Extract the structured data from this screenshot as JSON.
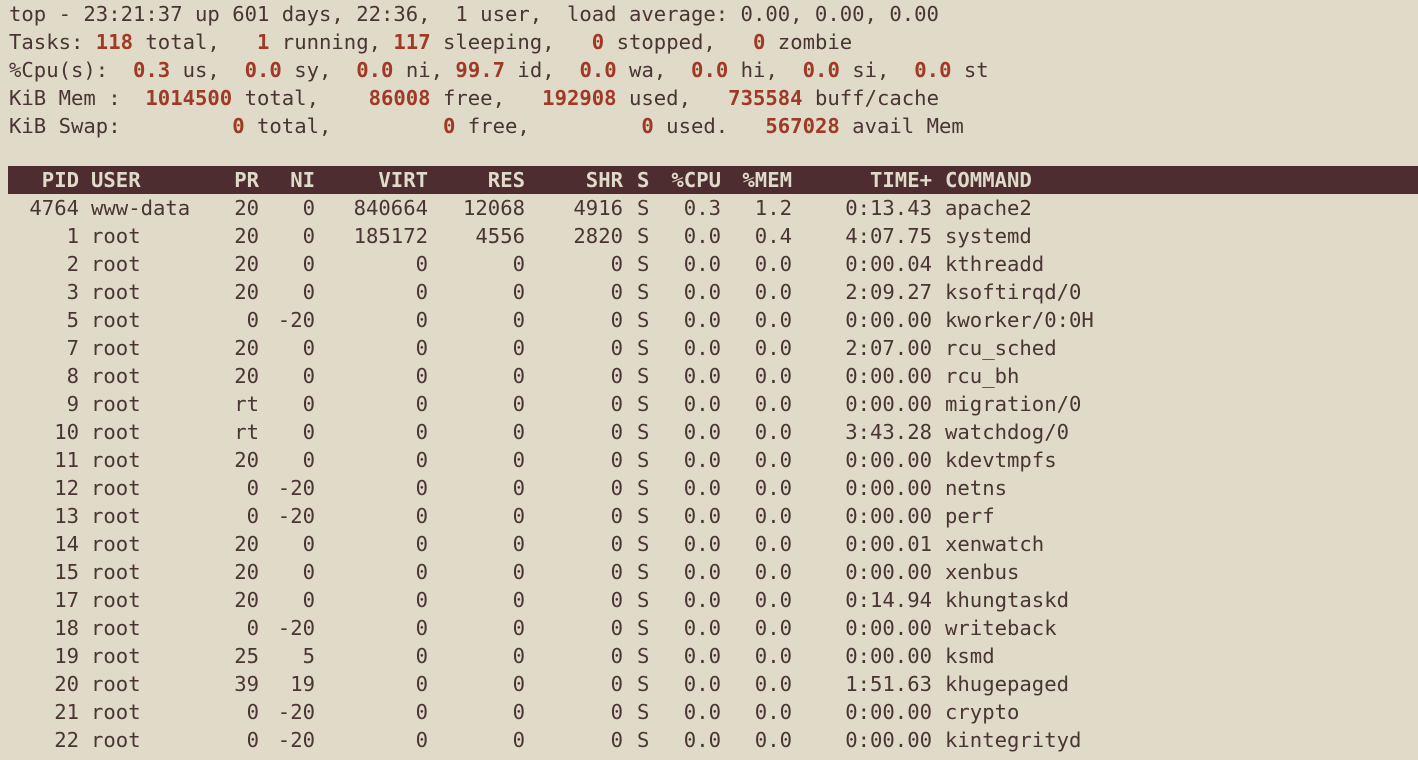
{
  "summary": {
    "line1": {
      "prefix": "top - ",
      "time": "23:21:37",
      "uptime": " up 601 days, 22:36,  1 user,  load average: 0.00, 0.00, 0.00"
    },
    "tasks": {
      "label": "Tasks: ",
      "total": "118",
      "total_label": " total,   ",
      "running": "1",
      "running_label": " running, ",
      "sleeping": "117",
      "sleeping_label": " sleeping,   ",
      "stopped": "0",
      "stopped_label": " stopped,   ",
      "zombie": "0",
      "zombie_label": " zombie"
    },
    "cpu": {
      "label": "%Cpu(s):  ",
      "us": "0.3",
      "us_label": " us,  ",
      "sy": "0.0",
      "sy_label": " sy,  ",
      "ni": "0.0",
      "ni_label": " ni, ",
      "id": "99.7",
      "id_label": " id,  ",
      "wa": "0.0",
      "wa_label": " wa,  ",
      "hi": "0.0",
      "hi_label": " hi,  ",
      "si": "0.0",
      "si_label": " si,  ",
      "st": "0.0",
      "st_label": " st"
    },
    "mem": {
      "label": "KiB Mem :  ",
      "total": "1014500",
      "total_label": " total,    ",
      "free": "86008",
      "free_label": " free,   ",
      "used": "192908",
      "used_label": " used,   ",
      "buff": "735584",
      "buff_label": " buff/cache"
    },
    "swap": {
      "label": "KiB Swap:         ",
      "total": "0",
      "total_label": " total,         ",
      "free": "0",
      "free_label": " free,         ",
      "used": "0",
      "used_label": " used.   ",
      "avail": "567028",
      "avail_label": " avail Mem"
    }
  },
  "columns": [
    "PID",
    "USER",
    "PR",
    "NI",
    "VIRT",
    "RES",
    "SHR",
    "S",
    "%CPU",
    "%MEM",
    "TIME+",
    "COMMAND"
  ],
  "processes": [
    [
      "4764",
      "www-data",
      "20",
      "0",
      "840664",
      "12068",
      "4916",
      "S",
      "0.3",
      "1.2",
      "0:13.43",
      "apache2"
    ],
    [
      "1",
      "root",
      "20",
      "0",
      "185172",
      "4556",
      "2820",
      "S",
      "0.0",
      "0.4",
      "4:07.75",
      "systemd"
    ],
    [
      "2",
      "root",
      "20",
      "0",
      "0",
      "0",
      "0",
      "S",
      "0.0",
      "0.0",
      "0:00.04",
      "kthreadd"
    ],
    [
      "3",
      "root",
      "20",
      "0",
      "0",
      "0",
      "0",
      "S",
      "0.0",
      "0.0",
      "2:09.27",
      "ksoftirqd/0"
    ],
    [
      "5",
      "root",
      "0",
      "-20",
      "0",
      "0",
      "0",
      "S",
      "0.0",
      "0.0",
      "0:00.00",
      "kworker/0:0H"
    ],
    [
      "7",
      "root",
      "20",
      "0",
      "0",
      "0",
      "0",
      "S",
      "0.0",
      "0.0",
      "2:07.00",
      "rcu_sched"
    ],
    [
      "8",
      "root",
      "20",
      "0",
      "0",
      "0",
      "0",
      "S",
      "0.0",
      "0.0",
      "0:00.00",
      "rcu_bh"
    ],
    [
      "9",
      "root",
      "rt",
      "0",
      "0",
      "0",
      "0",
      "S",
      "0.0",
      "0.0",
      "0:00.00",
      "migration/0"
    ],
    [
      "10",
      "root",
      "rt",
      "0",
      "0",
      "0",
      "0",
      "S",
      "0.0",
      "0.0",
      "3:43.28",
      "watchdog/0"
    ],
    [
      "11",
      "root",
      "20",
      "0",
      "0",
      "0",
      "0",
      "S",
      "0.0",
      "0.0",
      "0:00.00",
      "kdevtmpfs"
    ],
    [
      "12",
      "root",
      "0",
      "-20",
      "0",
      "0",
      "0",
      "S",
      "0.0",
      "0.0",
      "0:00.00",
      "netns"
    ],
    [
      "13",
      "root",
      "0",
      "-20",
      "0",
      "0",
      "0",
      "S",
      "0.0",
      "0.0",
      "0:00.00",
      "perf"
    ],
    [
      "14",
      "root",
      "20",
      "0",
      "0",
      "0",
      "0",
      "S",
      "0.0",
      "0.0",
      "0:00.01",
      "xenwatch"
    ],
    [
      "15",
      "root",
      "20",
      "0",
      "0",
      "0",
      "0",
      "S",
      "0.0",
      "0.0",
      "0:00.00",
      "xenbus"
    ],
    [
      "17",
      "root",
      "20",
      "0",
      "0",
      "0",
      "0",
      "S",
      "0.0",
      "0.0",
      "0:14.94",
      "khungtaskd"
    ],
    [
      "18",
      "root",
      "0",
      "-20",
      "0",
      "0",
      "0",
      "S",
      "0.0",
      "0.0",
      "0:00.00",
      "writeback"
    ],
    [
      "19",
      "root",
      "25",
      "5",
      "0",
      "0",
      "0",
      "S",
      "0.0",
      "0.0",
      "0:00.00",
      "ksmd"
    ],
    [
      "20",
      "root",
      "39",
      "19",
      "0",
      "0",
      "0",
      "S",
      "0.0",
      "0.0",
      "1:51.63",
      "khugepaged"
    ],
    [
      "21",
      "root",
      "0",
      "-20",
      "0",
      "0",
      "0",
      "S",
      "0.0",
      "0.0",
      "0:00.00",
      "crypto"
    ],
    [
      "22",
      "root",
      "0",
      "-20",
      "0",
      "0",
      "0",
      "S",
      "0.0",
      "0.0",
      "0:00.00",
      "kintegrityd"
    ]
  ],
  "colors": {
    "background": "#e0dbc8",
    "text": "#4a3434",
    "highlight": "#9e3a26",
    "header_bg": "#4d2d2f"
  }
}
